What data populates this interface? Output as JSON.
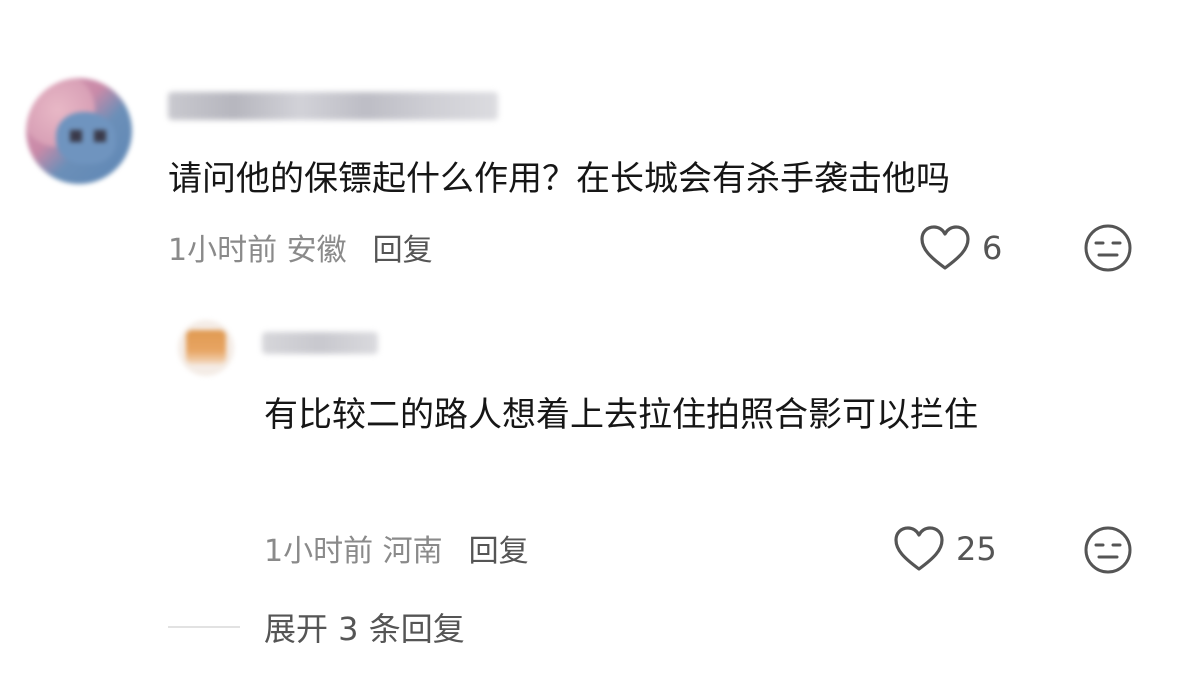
{
  "comment": {
    "text": "请问他的保镖起什么作用？在长城会有杀手袭击他吗",
    "meta": "1小时前 安徽",
    "reply_label": "回复",
    "likes": "6",
    "like_icon": "heart-outline-icon",
    "dislike_icon": "meh-face-icon"
  },
  "reply": {
    "text": "有比较二的路人想着上去拉住拍照合影可以拦住",
    "meta": "1小时前 河南",
    "reply_label": "回复",
    "likes": "25",
    "like_icon": "heart-outline-icon",
    "dislike_icon": "meh-face-icon"
  },
  "expand": {
    "label": "展开 3 条回复"
  },
  "colors": {
    "text_primary": "#161616",
    "text_secondary": "#8a8a8a",
    "icon": "#555555"
  }
}
